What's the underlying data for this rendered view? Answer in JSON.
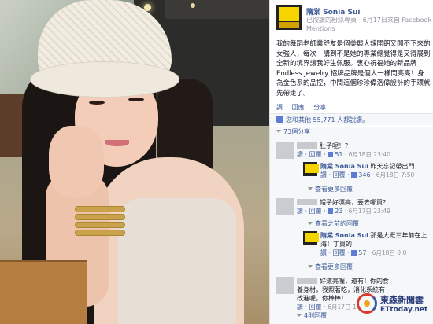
{
  "post": {
    "page_name": "隋棠 Sonia Sui",
    "subline": "已按讚的粉絲專頁 · 6月17日來自 Facebook Mentions",
    "text": "我的舞蹈老師業舒友是個美麗大辣開朗又閒不下來的女強人，每次一講到不是她的專業總覺得是又得展到全新的境界讓我好生佩服。衷心祝福她的新品牌 Endless Jewelry 招牌品牌是個人一樣閃亮亮！身為金色系的品控，中間這個珍珍偉洛偉設計的手環就先帶走了。",
    "actions": [
      "讚",
      "回應",
      "分享"
    ],
    "likes_text": "您和其他 55,771 人都說讚。",
    "shares_text": "73個分享"
  },
  "comments": [
    {
      "text": "肚子呢！？",
      "actions": "讚 · 回覆 · ",
      "likes": "51",
      "time": " · 6月18日 23:40"
    },
    {
      "author": "隋棠 Sonia Sui",
      "text": "昨天忘記帶出門！",
      "actions": "讚 · 回覆 · ",
      "likes": "346",
      "time": " · 6月18日 7:50"
    },
    {
      "more_replies": "查看更多回覆"
    },
    {
      "text": "帽子好漂亮，要去哪買？",
      "actions": "讚 · 回覆 · ",
      "likes": "23",
      "time": " · 6月17日 23:49"
    },
    {
      "earlier_replies": "查看之前的回覆"
    },
    {
      "author": "隋棠 Sonia Sui",
      "text": "那是大概三年前在上海！丁買的",
      "actions": "讚 · 回覆 · ",
      "likes": "57",
      "time": " · 6月18日 0:0"
    },
    {
      "more_replies": "查看更多回覆"
    },
    {
      "text": "好漂亮喔，還有！你的食養身材，我照著吃，消化系統有改進喔，你棒棒！",
      "actions": "讚 · 回覆 · ",
      "likes": "",
      "time": "6月17日 1"
    },
    {
      "reply_count": "4則回覆"
    }
  ],
  "watermark": {
    "name": "東森新聞雲",
    "domain": "ETtoday.net"
  },
  "icons": {
    "thumb": "like-thumb-icon",
    "arrow": "reply-arrow-icon"
  },
  "colors": {
    "fb_link": "#3b5998",
    "meta": "#90949c"
  }
}
